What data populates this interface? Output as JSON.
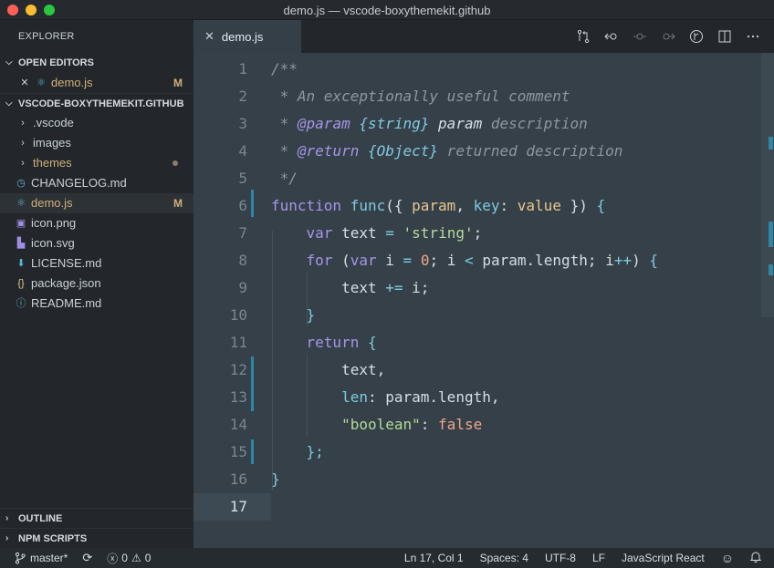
{
  "window": {
    "title": "demo.js — vscode-boxythemekit.github"
  },
  "sidebar": {
    "header": "EXPLORER",
    "open_editors": {
      "title": "OPEN EDITORS",
      "items": [
        {
          "name": "demo.js",
          "badge": "M"
        }
      ]
    },
    "folder": {
      "title": "VSCODE-BOXYTHEMEKIT.GITHUB",
      "items": [
        {
          "name": ".vscode",
          "type": "folder"
        },
        {
          "name": "images",
          "type": "folder"
        },
        {
          "name": "themes",
          "type": "folder",
          "modified_dot": true
        },
        {
          "name": "CHANGELOG.md",
          "icon": "clock-icon"
        },
        {
          "name": "demo.js",
          "icon": "react-icon",
          "badge": "M"
        },
        {
          "name": "icon.png",
          "icon": "image-icon"
        },
        {
          "name": "icon.svg",
          "icon": "svg-icon"
        },
        {
          "name": "LICENSE.md",
          "icon": "license-icon"
        },
        {
          "name": "package.json",
          "icon": "json-icon"
        },
        {
          "name": "README.md",
          "icon": "info-icon"
        }
      ]
    },
    "outline": "OUTLINE",
    "npm_scripts": "NPM SCRIPTS"
  },
  "tabs": [
    {
      "label": "demo.js",
      "active": true
    }
  ],
  "editor": {
    "current_line": 17,
    "line_numbers": [
      "1",
      "2",
      "3",
      "4",
      "5",
      "6",
      "7",
      "8",
      "9",
      "10",
      "11",
      "12",
      "13",
      "14",
      "15",
      "16",
      "17"
    ]
  },
  "statusbar": {
    "branch": "master*",
    "errors": "0",
    "warnings": "0",
    "position": "Ln 17, Col 1",
    "spaces": "Spaces: 4",
    "encoding": "UTF-8",
    "eol": "LF",
    "language": "JavaScript React"
  },
  "colors": {
    "accent": "#2f86a8",
    "editor_bg": "#354048",
    "modified": "#d0b07a"
  }
}
